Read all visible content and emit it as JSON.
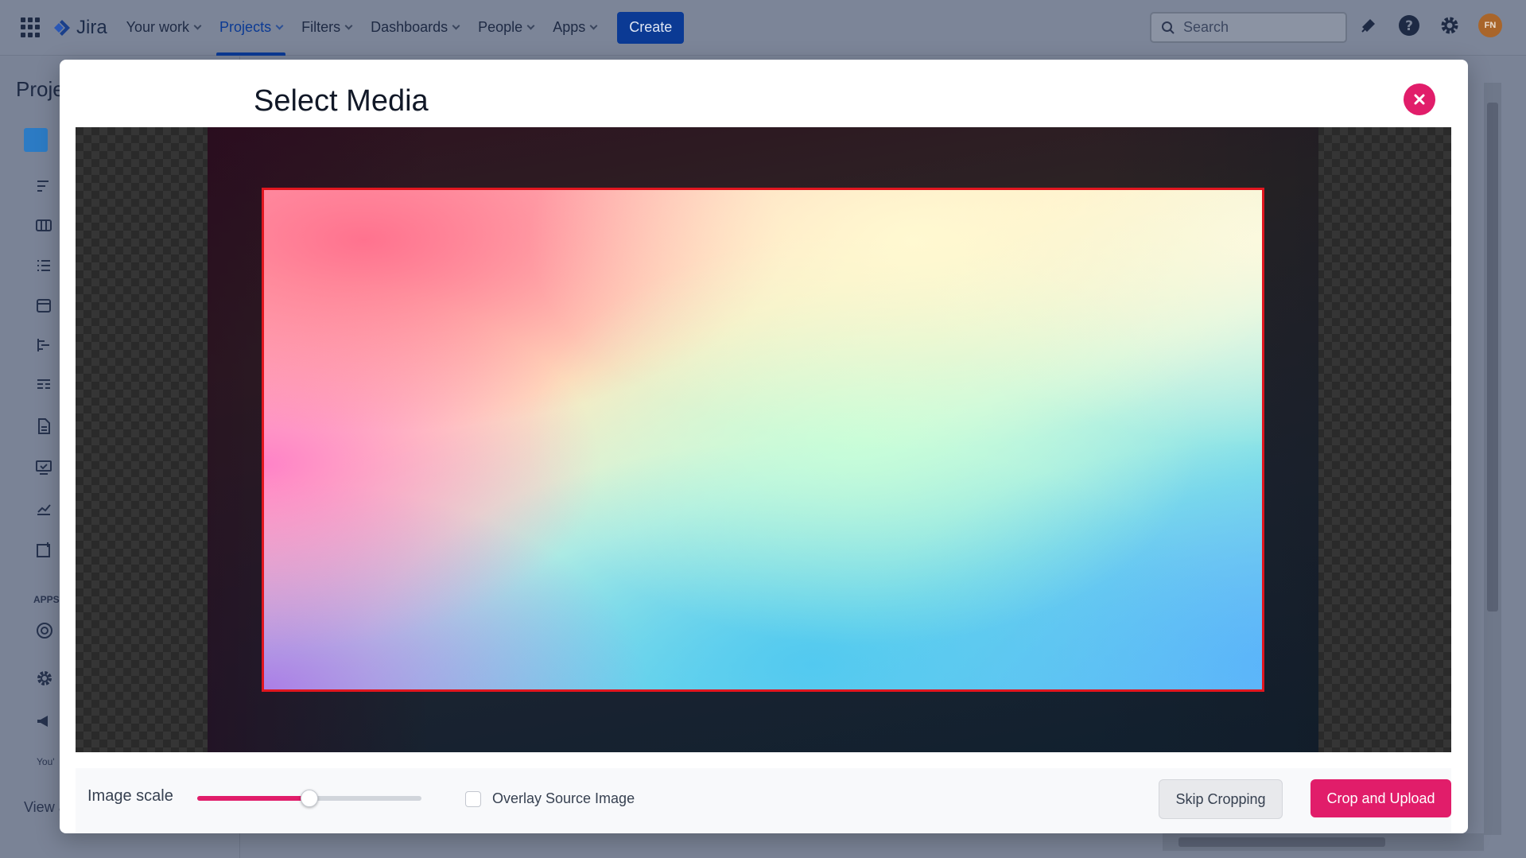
{
  "topnav": {
    "logo_text": "Jira",
    "items": [
      {
        "label": "Your work"
      },
      {
        "label": "Projects"
      },
      {
        "label": "Filters"
      },
      {
        "label": "Dashboards"
      },
      {
        "label": "People"
      },
      {
        "label": "Apps"
      }
    ],
    "active_item": "Projects",
    "create_label": "Create",
    "search_placeholder": "Search",
    "avatar_initials": "FN"
  },
  "sidebar": {
    "title": "Proje",
    "apps_heading": "APPS",
    "footer_text": "You'",
    "view_link": "View a"
  },
  "modal": {
    "title": "Select Media",
    "image_scale_label": "Image scale",
    "image_scale_value": 0.5,
    "overlay_label": "Overlay Source Image",
    "overlay_checked": false,
    "skip_label": "Skip Cropping",
    "upload_label": "Crop and Upload"
  },
  "colors": {
    "accent": "#e11d6a",
    "jira_blue": "#0b3a94",
    "crop_border": "#e0161f"
  }
}
